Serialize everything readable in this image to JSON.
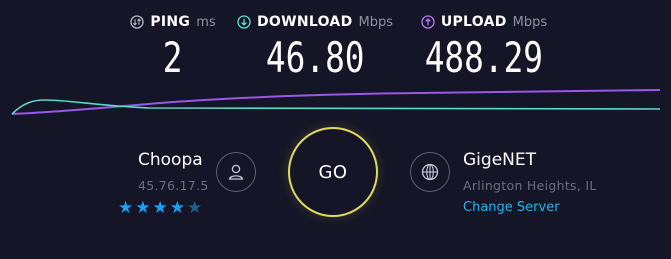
{
  "metrics": {
    "ping": {
      "label": "PING",
      "unit": "ms",
      "value": "2",
      "icon": "ping-icon",
      "color": "#b6b8c8"
    },
    "download": {
      "label": "DOWNLOAD",
      "unit": "Mbps",
      "value": "46.80",
      "icon": "download-arrow-icon",
      "color": "#5fe0d1"
    },
    "upload": {
      "label": "UPLOAD",
      "unit": "Mbps",
      "value": "488.29",
      "icon": "upload-arrow-icon",
      "color": "#b47cf5"
    }
  },
  "graph": {
    "download_color": "#59d8cc",
    "upload_color": "#9a58e8"
  },
  "host": {
    "name": "Choopa",
    "ip": "45.76.17.5",
    "rating": 4,
    "rating_max": 5,
    "icon": "user-icon"
  },
  "go_button": {
    "label": "GO",
    "color": "#e2da5b"
  },
  "server": {
    "name": "GigeNET",
    "location": "Arlington Heights, IL",
    "change_label": "Change Server",
    "icon": "globe-icon",
    "link_color": "#1fb6f5"
  }
}
